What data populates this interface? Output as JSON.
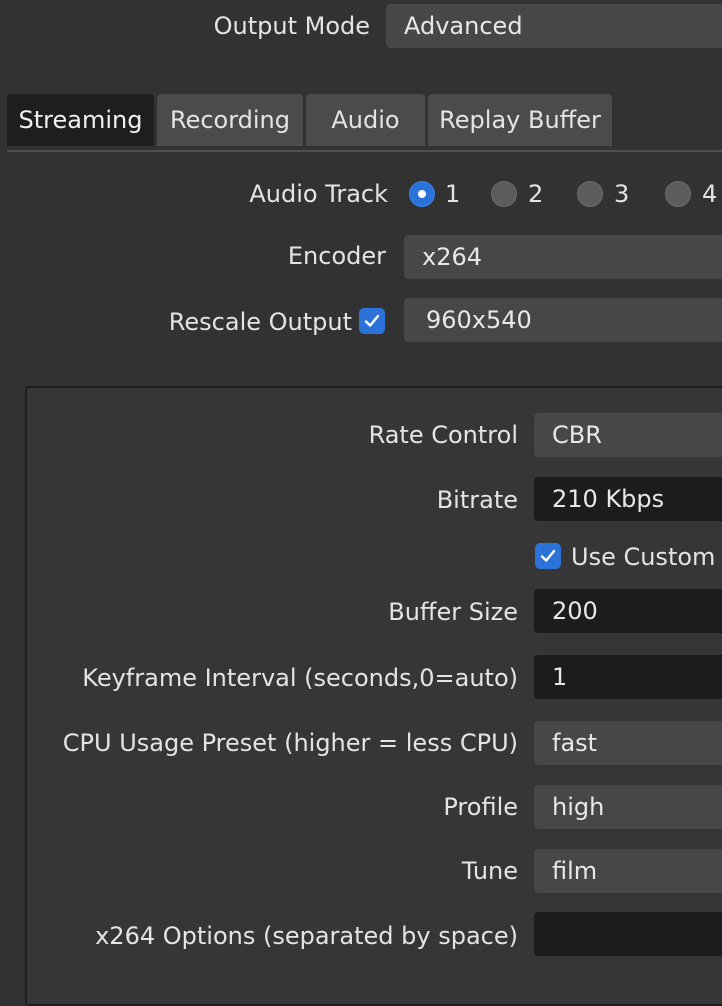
{
  "output_mode": {
    "label": "Output Mode",
    "value": "Advanced"
  },
  "tabs": [
    {
      "label": "Streaming",
      "active": true
    },
    {
      "label": "Recording",
      "active": false
    },
    {
      "label": "Audio",
      "active": false
    },
    {
      "label": "Replay Buffer",
      "active": false
    }
  ],
  "audio_track": {
    "label": "Audio Track",
    "options": [
      "1",
      "2",
      "3",
      "4"
    ],
    "selected": "1"
  },
  "encoder": {
    "label": "Encoder",
    "value": "x264"
  },
  "rescale_output": {
    "label": "Rescale Output",
    "checked": true,
    "value": "960x540"
  },
  "settings": {
    "rate_control": {
      "label": "Rate Control",
      "value": "CBR"
    },
    "bitrate": {
      "label": "Bitrate",
      "value": "210 Kbps"
    },
    "use_custom": {
      "label": "Use Custom",
      "checked": true
    },
    "buffer_size": {
      "label": "Buffer Size",
      "value": "200"
    },
    "keyframe_interval": {
      "label": "Keyframe Interval (seconds,0=auto)",
      "value": "1"
    },
    "cpu_preset": {
      "label": "CPU Usage Preset (higher = less CPU)",
      "value": "fast"
    },
    "profile": {
      "label": "Profile",
      "value": "high"
    },
    "tune": {
      "label": "Tune",
      "value": "film"
    },
    "x264_options": {
      "label": "x264 Options (separated by space)",
      "value": ""
    }
  },
  "colors": {
    "accent": "#2c73d9",
    "background": "#323232",
    "combo": "#474747",
    "spin": "#1c1c1c"
  }
}
